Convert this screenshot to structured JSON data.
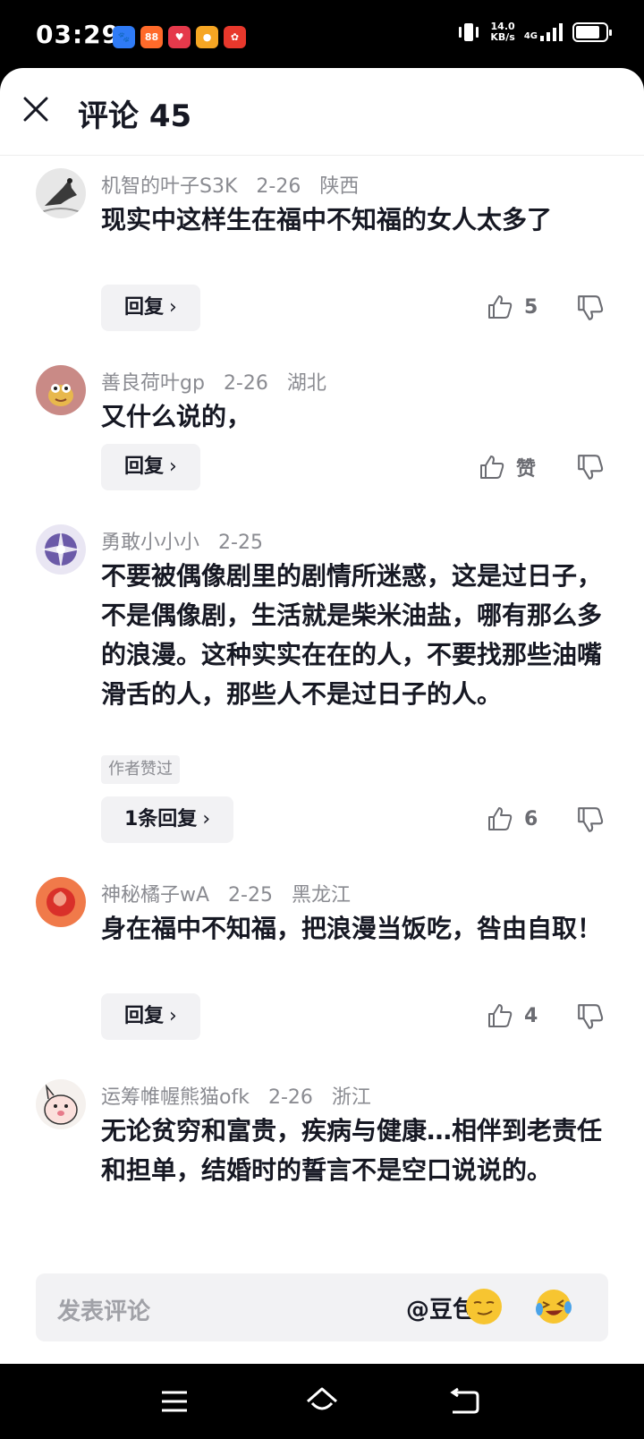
{
  "status_bar": {
    "time": "03:29",
    "net_speed_value": "14.0",
    "net_speed_unit": "KB/s",
    "network": "4G",
    "app_icons": [
      {
        "icon": "baidu-map-icon",
        "color": "#2f7bf6",
        "label": "🐾"
      },
      {
        "icon": "taobao-icon",
        "color": "#ff6a2a",
        "label": "88"
      },
      {
        "icon": "red-app-icon",
        "color": "#e5394b",
        "label": "♥"
      },
      {
        "icon": "orange-app-icon",
        "color": "#f6a623",
        "label": "●"
      },
      {
        "icon": "pinduoduo-icon",
        "color": "#e8382c",
        "label": "✿"
      }
    ]
  },
  "header": {
    "title": "评论 45"
  },
  "comments": [
    {
      "user": "机智的叶子S3K",
      "date": "2-26",
      "location": "陕西",
      "text": "现实中这样生在福中不知福的女人太多了",
      "reply_label": "回复",
      "likes": "5",
      "author_liked": "",
      "avatar": "avatar-horse-sketch"
    },
    {
      "user": "善良荷叶gp",
      "date": "2-26",
      "location": "湖北",
      "text": "又什么说的，",
      "reply_label": "回复",
      "likes": "赞",
      "author_liked": "",
      "avatar": "avatar-cartoon-frog"
    },
    {
      "user": "勇敢小小小",
      "date": "2-25",
      "location": "",
      "text": "不要被偶像剧里的剧情所迷惑，这是过日子，不是偶像剧，生活就是柴米油盐，哪有那么多的浪漫。这种实实在在的人，不要找那些油嘴滑舌的人，那些人不是过日子的人。",
      "reply_label": "1条回复",
      "likes": "6",
      "author_liked": "作者赞过",
      "avatar": "avatar-purple-sparkle"
    },
    {
      "user": "神秘橘子wA",
      "date": "2-25",
      "location": "黑龙江",
      "text": "身在福中不知福，把浪漫当饭吃，咎由自取！",
      "reply_label": "回复",
      "likes": "4",
      "author_liked": "",
      "avatar": "avatar-red-rose"
    },
    {
      "user": "运筹帷幄熊猫ofk",
      "date": "2-26",
      "location": "浙江",
      "text": "无论贫穷和富贵，疾病与健康…相伴到老责任和担单，结婚时的誓言不是空口说说的。",
      "reply_label": "",
      "likes": "",
      "author_liked": "",
      "avatar": "avatar-pink-cartoon"
    }
  ],
  "input_bar": {
    "placeholder": "发表评论",
    "mention": "@豆包",
    "emoji_1": "smirk-emoji-icon",
    "emoji_2": "laughing-crying-emoji-icon"
  },
  "nav_bar": {
    "buttons": [
      "menu-icon",
      "home-icon",
      "back-icon"
    ]
  },
  "colors": {
    "text_primary": "#161823",
    "text_secondary": "#8a8b91",
    "chip_bg": "#f2f2f4"
  }
}
